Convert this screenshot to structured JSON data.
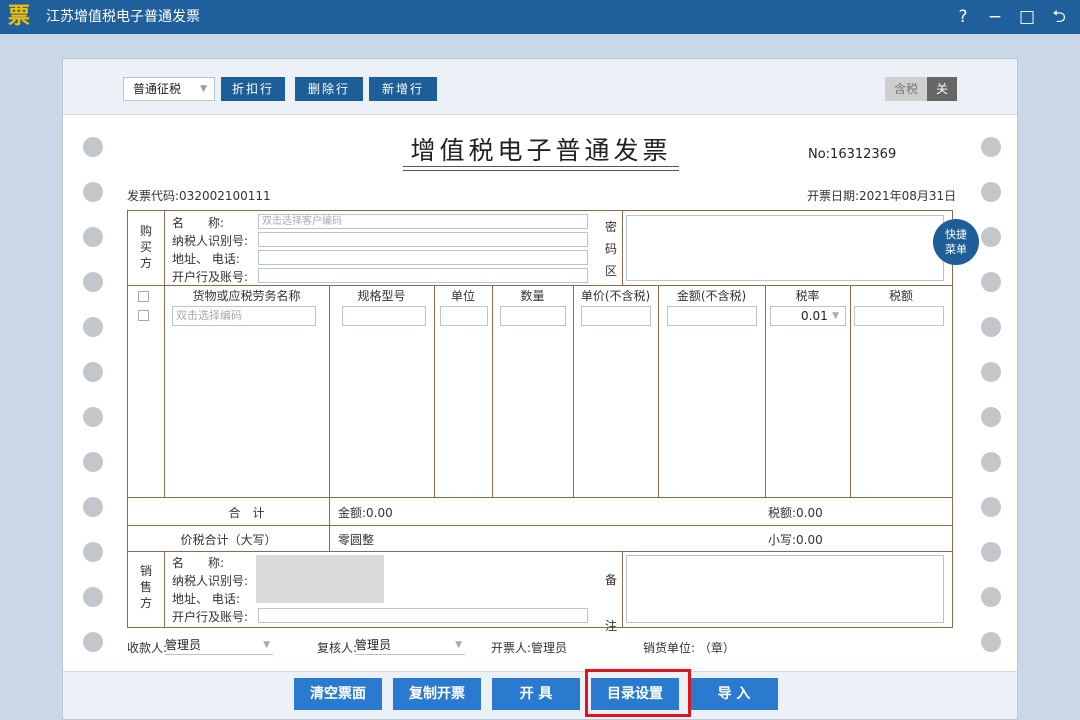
{
  "window": {
    "logo_char": "票",
    "title": "江苏增值税电子普通发票",
    "help": "?",
    "minimize": "−",
    "maximize": "□",
    "back": "⮌"
  },
  "toolbar": {
    "tax_type": "普通征税",
    "discount": "折扣行",
    "delete_row": "删除行",
    "add_row": "新增行",
    "tax_included": "含税",
    "tax_toggle": "关"
  },
  "invoice": {
    "title": "增值税电子普通发票",
    "number": "No:16312369",
    "code": "发票代码:032002100111",
    "date": "开票日期:2021年08月31日"
  },
  "buyer": {
    "side_label": [
      "购",
      "买",
      "方"
    ],
    "name_label": "名　　称:",
    "name_placeholder": "双击选择客户编码",
    "tax_id_label": "纳税人识别号:",
    "address_label": "地址、 电话:",
    "bank_label": "开户行及账号:",
    "cipher_label": [
      "密",
      "码",
      "区"
    ]
  },
  "items": {
    "headers": [
      "货物或应税劳务名称",
      "规格型号",
      "单位",
      "数量",
      "单价(不含税)",
      "金额(不含税)",
      "税率",
      "税额"
    ],
    "name_placeholder": "双击选择编码",
    "tax_rate": "0.01"
  },
  "totals": {
    "label": "合　计",
    "amount": "金额:0.00",
    "tax": "税额:0.00",
    "grand_label": "价税合计（大写）",
    "grand_upper": "零圆整",
    "grand_lower": "小写:0.00"
  },
  "seller": {
    "side_label": [
      "销",
      "售",
      "方"
    ],
    "name_label": "名　　称:",
    "tax_id_label": "纳税人识别号:",
    "address_label": "地址、 电话:",
    "bank_label": "开户行及账号:",
    "remark_label": [
      "备",
      "注"
    ]
  },
  "quick_menu": [
    "快捷",
    "菜单"
  ],
  "footer": {
    "payee_label": "收款人:",
    "payee": "管理员",
    "reviewer_label": "复核人:",
    "reviewer": "管理员",
    "issuer": "开票人:管理员",
    "seller_unit": "销货单位: （章）"
  },
  "actions": {
    "clear": "清空票面",
    "copy": "复制开票",
    "issue": "开 具",
    "catalog": "目录设置",
    "import": "导 入"
  }
}
